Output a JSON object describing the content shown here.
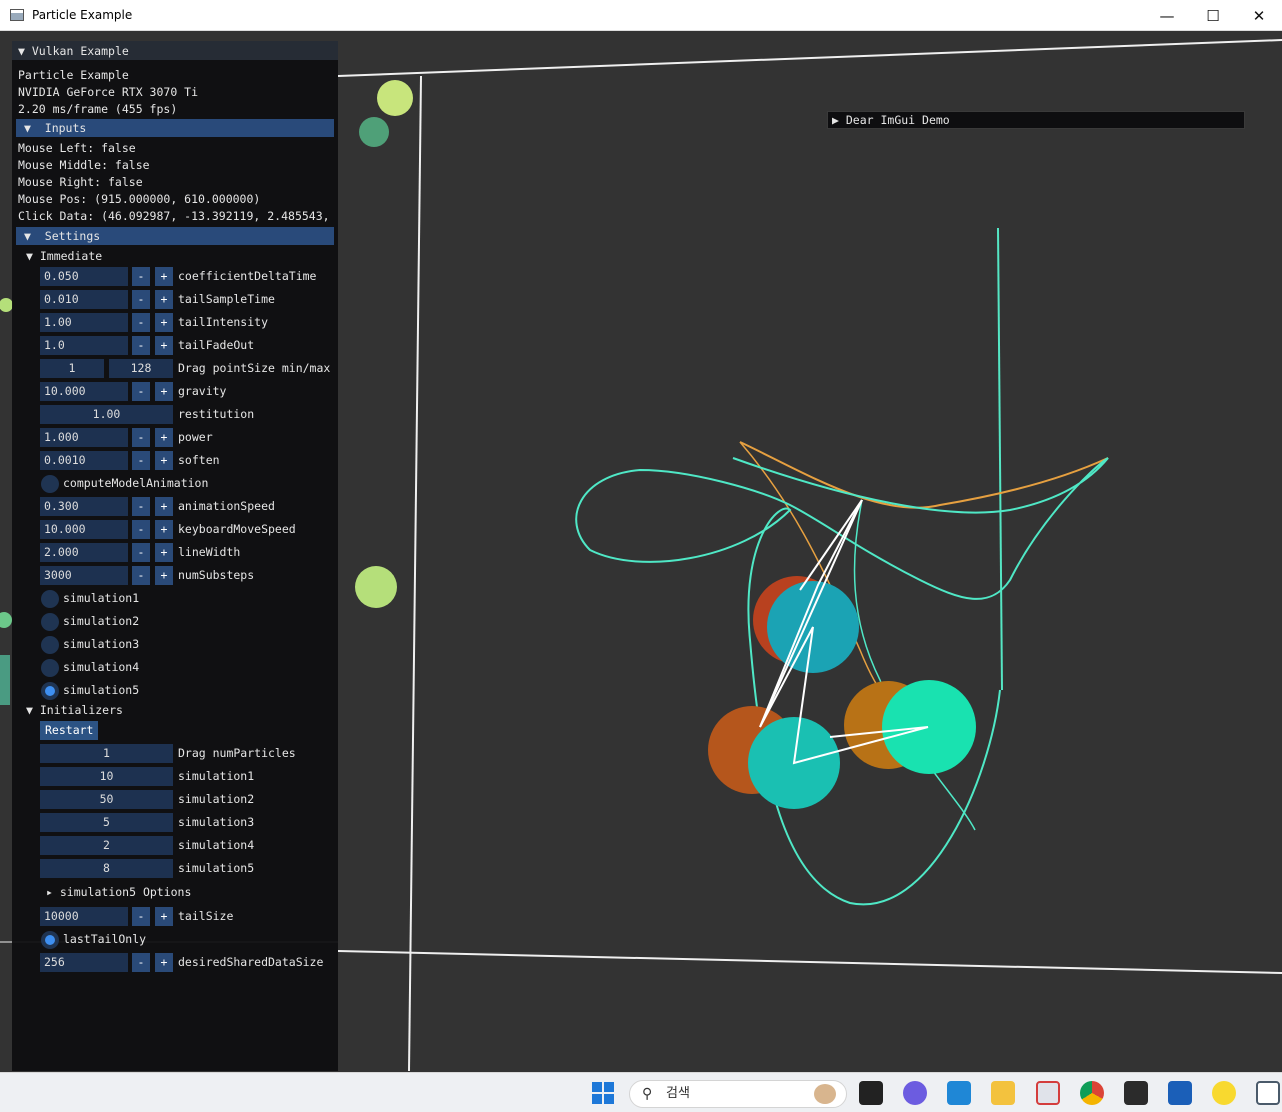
{
  "window": {
    "title": "Particle Example",
    "controls": [
      "—",
      "☐",
      "✕"
    ]
  },
  "panel": {
    "header": "Vulkan Example",
    "info": [
      "Particle Example",
      "NVIDIA GeForce RTX 3070 Ti",
      "2.20 ms/frame (455 fps)"
    ],
    "inputs_label": "Inputs",
    "inputs": [
      "Mouse Left: false",
      "Mouse Middle: false",
      "Mouse Right: false",
      "Mouse Pos: (915.000000, 610.000000)",
      "Click Data: (46.092987, -13.392119, 2.485543,"
    ],
    "settings_label": "Settings",
    "immediate_label": "Immediate",
    "steppers": [
      {
        "value": "0.050",
        "label": "coefficientDeltaTime"
      },
      {
        "value": "0.010",
        "label": "tailSampleTime"
      },
      {
        "value": "1.00",
        "label": "tailIntensity"
      },
      {
        "value": "1.0",
        "label": "tailFadeOut"
      }
    ],
    "pointsize": {
      "min": "1",
      "max": "128",
      "label": "Drag pointSize min/max"
    },
    "gravity": {
      "value": "10.000",
      "label": "gravity"
    },
    "restitution": {
      "value": "1.00",
      "label": "restitution"
    },
    "power": {
      "value": "1.000",
      "label": "power"
    },
    "soften": {
      "value": "0.0010",
      "label": "soften"
    },
    "computeModelAnimation": "computeModelAnimation",
    "steppers2": [
      {
        "value": "0.300",
        "label": "animationSpeed"
      },
      {
        "value": "10.000",
        "label": "keyboardMoveSpeed"
      },
      {
        "value": "2.000",
        "label": "lineWidth"
      },
      {
        "value": "3000",
        "label": "numSubsteps"
      }
    ],
    "simulations": [
      "simulation1",
      "simulation2",
      "simulation3",
      "simulation4",
      "simulation5"
    ],
    "simulation_selected": 5,
    "initializers_label": "Initializers",
    "restart_label": "Restart",
    "drags": [
      {
        "value": "1",
        "label": "Drag numParticles"
      },
      {
        "value": "10",
        "label": "simulation1"
      },
      {
        "value": "50",
        "label": "simulation2"
      },
      {
        "value": "5",
        "label": "simulation3"
      },
      {
        "value": "2",
        "label": "simulation4"
      },
      {
        "value": "8",
        "label": "simulation5"
      }
    ],
    "sim5_options": "simulation5 Options",
    "tailSize": {
      "value": "10000",
      "label": "tailSize"
    },
    "lastTailOnly": "lastTailOnly",
    "desiredSharedDataSize": {
      "value": "256",
      "label": "desiredSharedDataSize"
    },
    "minus": "-",
    "plus": "+"
  },
  "demo_window": {
    "label": "Dear ImGui Demo"
  },
  "taskbar": {
    "search_placeholder": "검색"
  },
  "colors": {
    "panel_section": "#294a7a",
    "field": "#1d3150",
    "button": "#2a4a78",
    "tail": "#4fe8c6",
    "tail_orange": "#e6a040"
  }
}
